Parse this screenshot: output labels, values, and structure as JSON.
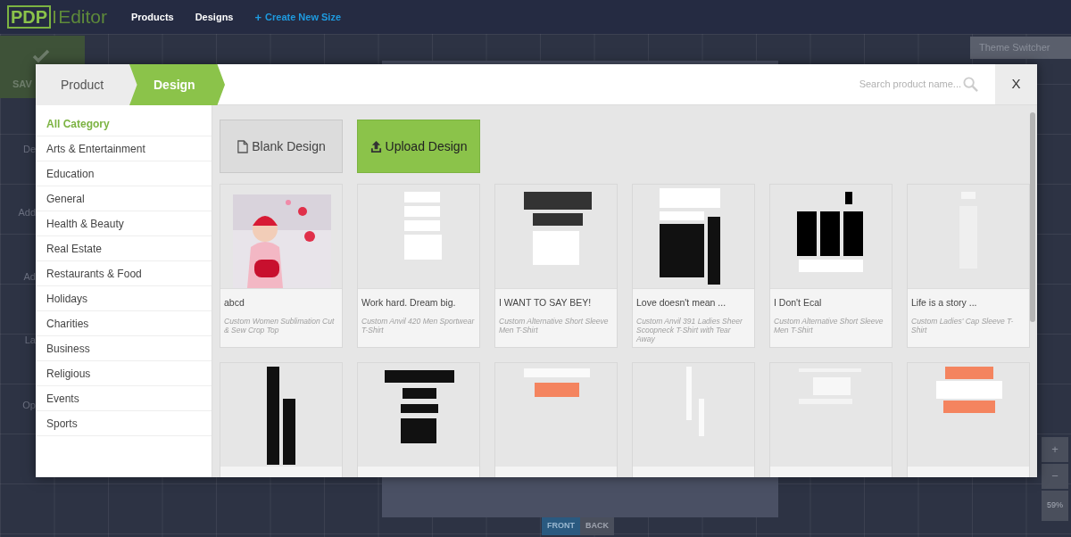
{
  "app_bar": {
    "logo": {
      "mark": "PDP",
      "text": "Editor"
    },
    "nav": [
      {
        "label": "Products",
        "kind": "plain"
      },
      {
        "label": "Designs",
        "kind": "plain"
      },
      {
        "label": "Create New Size",
        "icon": "+",
        "kind": "accent"
      }
    ]
  },
  "background": {
    "save_label": "SAV",
    "tool_labels": [
      "De",
      "Add",
      "Ad",
      "La",
      "Op"
    ],
    "theme_switcher": "Theme Switcher",
    "zoom_buttons": [
      "+",
      "−"
    ],
    "zoom_level": "59%",
    "sides": [
      {
        "label": "FRONT",
        "selected": true
      },
      {
        "label": "BACK",
        "selected": false
      }
    ]
  },
  "modal": {
    "steps": [
      {
        "label": "Product",
        "selected": false
      },
      {
        "label": "Design",
        "selected": true
      }
    ],
    "search": {
      "placeholder": "Search product name..."
    },
    "close": "X",
    "categories": [
      {
        "label": "All Category",
        "selected": true
      },
      {
        "label": "Arts & Entertainment",
        "selected": false
      },
      {
        "label": "Education",
        "selected": false
      },
      {
        "label": "General",
        "selected": false
      },
      {
        "label": "Health & Beauty",
        "selected": false
      },
      {
        "label": "Real Estate",
        "selected": false
      },
      {
        "label": "Restaurants & Food",
        "selected": false
      },
      {
        "label": "Holidays",
        "selected": false
      },
      {
        "label": "Charities",
        "selected": false
      },
      {
        "label": "Business",
        "selected": false
      },
      {
        "label": "Religious",
        "selected": false
      },
      {
        "label": "Events",
        "selected": false
      },
      {
        "label": "Sports",
        "selected": false
      }
    ],
    "actions": [
      {
        "label": "Blank Design",
        "kind": "blank"
      },
      {
        "label": "Upload Design",
        "kind": "upload"
      }
    ],
    "designs": [
      {
        "kind": "picture",
        "title": "abcd",
        "product": "Custom Women Sublimation Cut & Sew Crop Top"
      },
      {
        "kind": "picture",
        "title": "Work hard. Dream big.",
        "product": "Custom Anvil 420 Men Sportwear T-Shirt"
      },
      {
        "kind": "picture",
        "title": "I WANT TO SAY BEY!",
        "product": "Custom Alternative Short Sleeve Men T-Shirt"
      },
      {
        "kind": "picture",
        "title": "Love doesn't mean ...",
        "product": "Custom Anvil 391 Ladies Sheer Scoopneck T-Shirt with Tear Away"
      },
      {
        "kind": "picture",
        "title": "I Don't Ecal",
        "product": "Custom Alternative Short Sleeve Men T-Shirt"
      },
      {
        "kind": "picture",
        "title": "Life is a story ...",
        "product": "Custom Ladies' Cap Sleeve T-Shirt"
      },
      {
        "kind": "picture"
      },
      {
        "kind": "picture"
      },
      {
        "kind": "picture"
      },
      {
        "kind": "picture"
      },
      {
        "kind": "picture"
      },
      {
        "kind": "picture"
      }
    ]
  }
}
